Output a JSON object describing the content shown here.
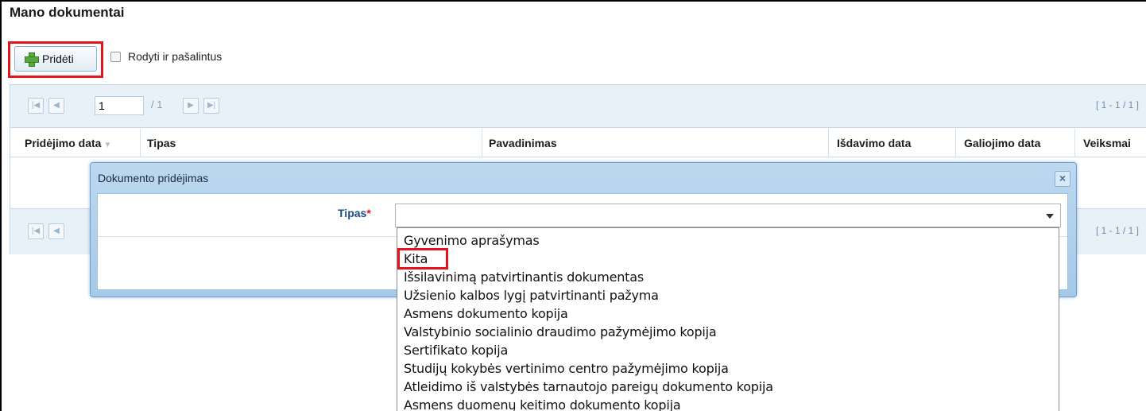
{
  "page": {
    "title": "Mano dokumentai"
  },
  "toolbar": {
    "add_label": "Pridėti",
    "show_removed_label": "Rodyti ir pašalintus"
  },
  "pager": {
    "current_page": "1",
    "total_pages": "/ 1",
    "range": "[ 1 - 1 / 1 ]"
  },
  "table": {
    "columns": [
      "Pridėjimo data",
      "Tipas",
      "Pavadinimas",
      "Išdavimo data",
      "Galiojimo data",
      "Veiksmai"
    ]
  },
  "dialog": {
    "title": "Dokumento pridėjimas",
    "type_label": "Tipas",
    "required_marker": "*",
    "type_value": "",
    "options": [
      "Gyvenimo aprašymas",
      "Kita",
      "Išsilavinimą patvirtinantis dokumentas",
      "Užsienio kalbos lygį patvirtinanti pažyma",
      "Asmens dokumento kopija",
      "Valstybinio socialinio draudimo pažymėjimo kopija",
      "Sertifikato kopija",
      "Studijų kokybės vertinimo centro pažymėjimo kopija",
      "Atleidimo iš valstybės tarnautojo pareigų dokumento kopija",
      "Asmens duomenų keitimo dokumento kopija"
    ]
  },
  "icons": {
    "add": "plus-icon",
    "first": "first-page-icon",
    "prev": "prev-page-icon",
    "next": "next-page-icon",
    "last": "last-page-icon",
    "close": "close-icon",
    "sort": "sort-desc-icon"
  },
  "colors": {
    "highlight": "#e3141c",
    "grid_header": "#e9f1f8",
    "dialog_header": "#a6c9e8",
    "add_icon": "#55a83a"
  }
}
